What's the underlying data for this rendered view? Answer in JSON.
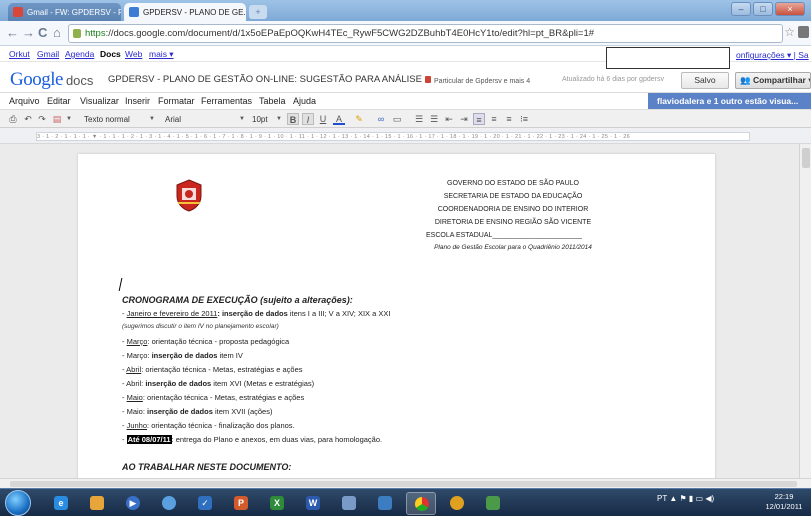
{
  "browser": {
    "tabs": [
      {
        "label": "Gmail - FW: GPDERSV - P...",
        "active": false,
        "favicon_color": "#d9473a"
      },
      {
        "label": "GPDERSV - PLANO DE GE...",
        "active": true,
        "favicon_color": "#3d7bd4"
      }
    ],
    "url_https": "https",
    "url_rest": "://docs.google.com/document/d/1x5oEPaEpOQKwH4TEc_RywF5CWG2DZBuhbT4E0HcY1to/edit?hl=pt_BR&pli=1#"
  },
  "google_bar": {
    "links": [
      "Orkut",
      "Gmail",
      "Agenda",
      "Docs",
      "Web",
      "mais ▾"
    ],
    "config_label": "onfigurações ▾ | Sa"
  },
  "docs_header": {
    "logo_google": "Google",
    "logo_docs": "docs",
    "doc_title": "GPDERSV - PLANO DE GESTÃO ON-LINE: SUGESTÃO PARA ANÁLISE",
    "privacy": "Particular de Gpdersv e mais 4",
    "updated": "Atualizado há 6 dias por gpdersv",
    "saved_label": "Salvo",
    "share_label": "Compartilhar ▾"
  },
  "menu": {
    "items": [
      "Arquivo",
      "Editar",
      "Visualizar",
      "Inserir",
      "Formatar",
      "Ferramentas",
      "Tabela",
      "Ajuda"
    ],
    "collab": "flaviodalera e 1 outro estão visua..."
  },
  "toolbar": {
    "style": "Texto normal",
    "font": "Arial",
    "size": "10pt"
  },
  "ruler": {
    "text": "3 · 1 · 2 · 1 · 1 · 1 · ▼ · 1 · 1 · 1 · 2 · 1 · 3 · 1 · 4 · 1 · 5 · 1 · 6 · 1 · 7 · 1 · 8 · 1 · 9 · 1 · 10 · 1 · 11 · 1 · 12 · 1 · 13 · 1 · 14 · 1 · 15 · 1 · 16 · 1 · 17 · 1 · 18 · 1 · 19 · 1 · 20 · 1 · 21 · 1 · 22 · 1 · 23 · 1 · 24 · 1 · 25 · 1 · 26"
  },
  "document": {
    "header_lines": [
      "GOVERNO DO ESTADO DE SÃO PAULO",
      "SECRETARIA DE ESTADO DA EDUCAÇÃO",
      "COORDENADORIA DE ENSINO DO INTERIOR",
      "DIRETORIA DE ENSINO REGIÃO SÃO VICENTE",
      "ESCOLA ESTADUAL_______________________"
    ],
    "header_subtitle": "Plano de Gestão Escolar para o Quadriênio 2011/2014",
    "heading1": "CRONOGRAMA DE EXECUÇÃO (sujeito a alterações):",
    "lines": [
      {
        "pre": "- ",
        "u": "Janeiro e fevereiro de 2011",
        "b": ": inserção de dados",
        "rest": " itens I a III; V a XIV; XIX a XXI"
      },
      {
        "note": "(sugerimos discutir o item IV no planejamento escolar)"
      },
      {
        "pre": "- ",
        "u": "Março",
        "b": "",
        "rest": ": orientação técnica - proposta pedagógica"
      },
      {
        "pre": "- Março: ",
        "u": "",
        "b": "inserção de dados",
        "rest": " item IV"
      },
      {
        "pre": "- ",
        "u": "Abril",
        "b": "",
        "rest": ": orientação técnica - Metas, estratégias e ações"
      },
      {
        "pre": "- Abril: ",
        "u": "",
        "b": "inserção de dados",
        "rest": " item XVI (Metas e estratégias)"
      },
      {
        "pre": "- ",
        "u": "Maio",
        "b": "",
        "rest": ": orientação técnica - Metas, estratégias e ações"
      },
      {
        "pre": "- Maio: ",
        "u": "",
        "b": "inserção de dados",
        "rest": " item XVII (ações)"
      },
      {
        "pre": "- ",
        "u": "Junho",
        "b": "",
        "rest": ": orientação técnica - finalização dos planos."
      },
      {
        "pre": "- ",
        "hl": "Até 08/07/11",
        "rest": ": entrega do Plano e anexos, em duas vias, para homologação."
      }
    ],
    "heading2": "AO TRABALHAR NESTE DOCUMENTO:"
  },
  "taskbar": {
    "tray_lang": "PT",
    "time": "22:19",
    "date": "12/01/2011"
  },
  "colors": {
    "collab_bar": "#5b82c7",
    "link": "#2a2ad0",
    "taskbar": "#1e3556"
  }
}
